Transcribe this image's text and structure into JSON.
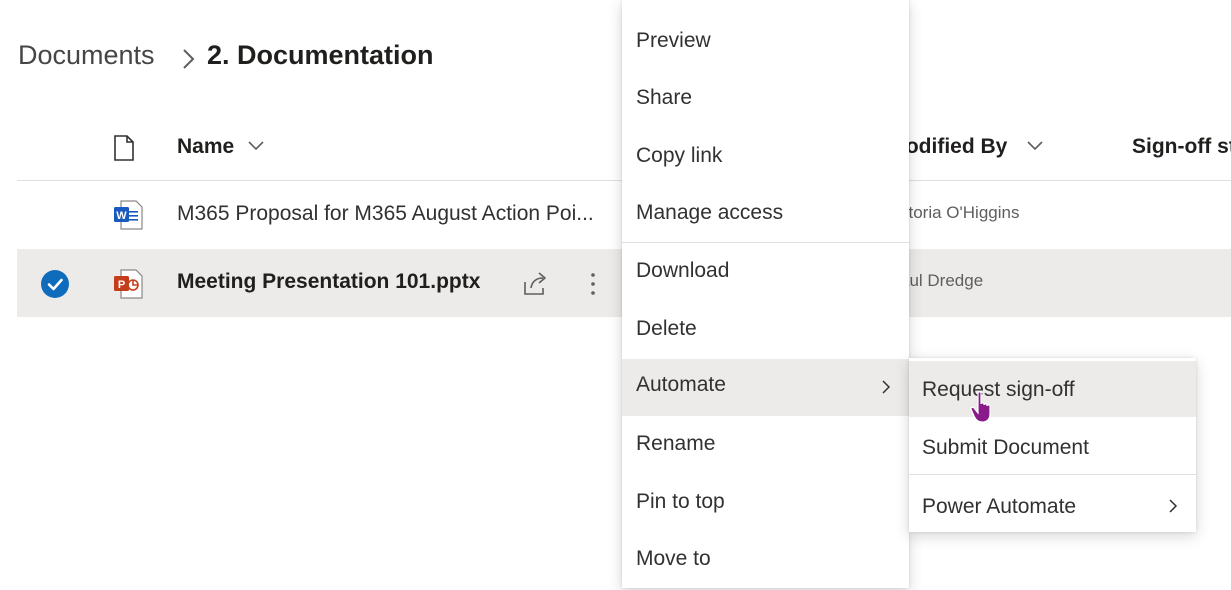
{
  "breadcrumb": {
    "root": "Documents",
    "current": "2. Documentation"
  },
  "columns": {
    "name": "Name",
    "modified_by": "lodified By",
    "sign_off": "Sign-off st"
  },
  "rows": [
    {
      "name": "M365 Proposal for M365 August Action Poi...",
      "modified_by": "ctoria O'Higgins",
      "file_type": "word-icon",
      "selected": false
    },
    {
      "name": "Meeting Presentation 101.pptx",
      "modified_by": "aul Dredge",
      "file_type": "powerpoint-icon",
      "selected": true
    }
  ],
  "context_menu": {
    "items": [
      {
        "label": "Preview"
      },
      {
        "label": "Share"
      },
      {
        "label": "Copy link"
      },
      {
        "label": "Manage access"
      },
      {
        "label": "Download"
      },
      {
        "label": "Delete"
      },
      {
        "label": "Automate",
        "has_submenu": true,
        "highlighted": true
      },
      {
        "label": "Rename"
      },
      {
        "label": "Pin to top"
      },
      {
        "label": "Move to"
      }
    ]
  },
  "submenu": {
    "items": [
      {
        "label": "Request sign-off",
        "highlighted": true
      },
      {
        "label": "Submit Document"
      },
      {
        "label": "Power Automate",
        "has_submenu": true
      }
    ]
  },
  "colors": {
    "accent": "#0f6cbd",
    "word": "#185abd",
    "powerpoint": "#c43e1c",
    "selected_row": "#edebe9",
    "cursor": "#8a1a8a"
  }
}
